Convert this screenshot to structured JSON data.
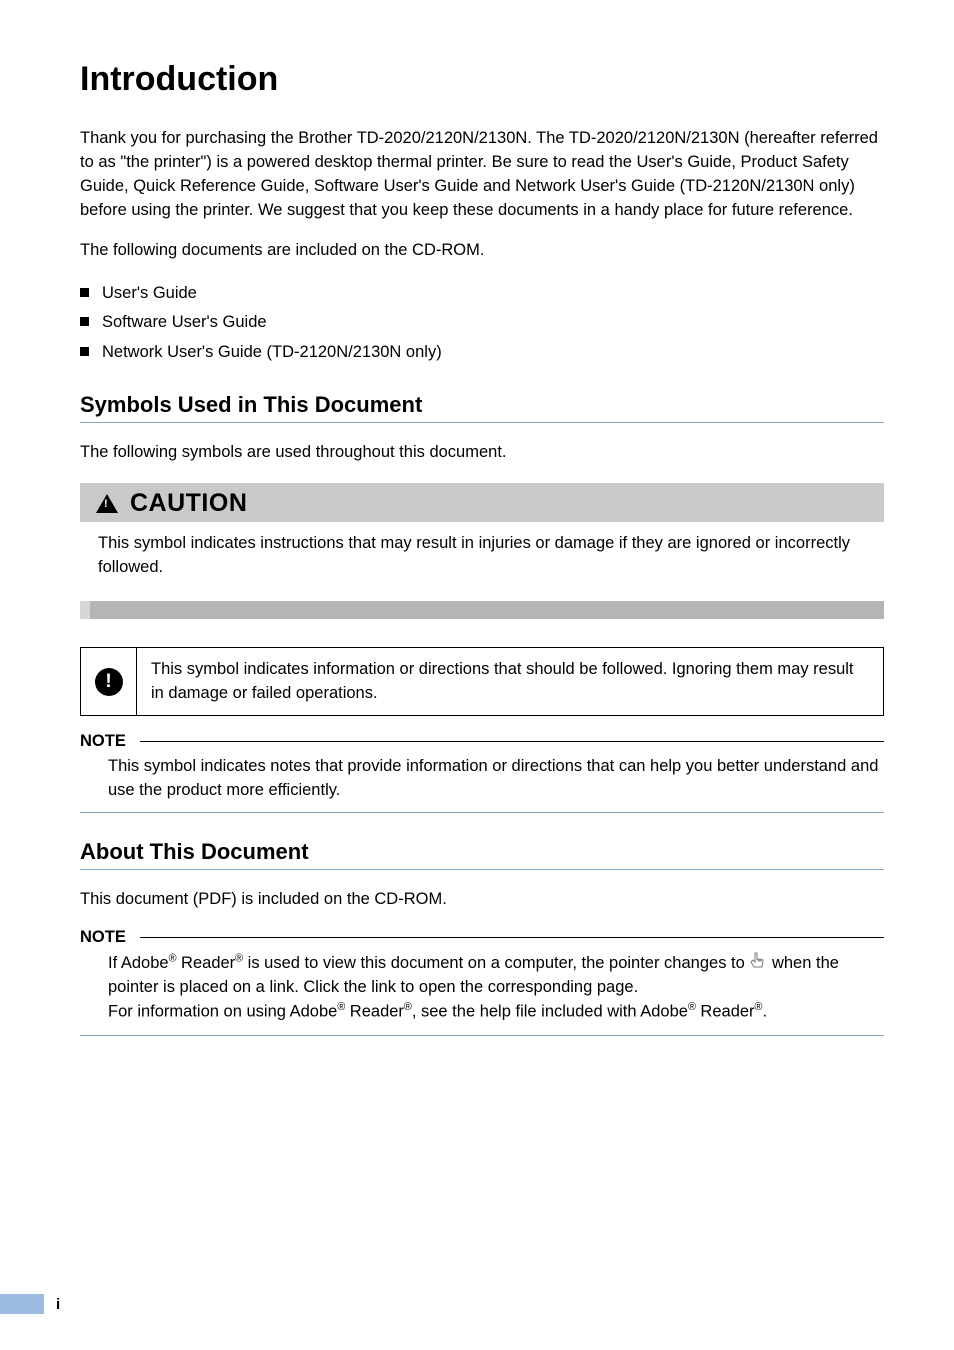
{
  "title": "Introduction",
  "intro_para": "Thank you for purchasing the Brother TD-2020/2120N/2130N. The TD-2020/2120N/2130N (hereafter referred to as \"the printer\") is a powered desktop thermal printer. Be sure to read the User's Guide, Product Safety Guide, Quick Reference Guide, Software User's Guide and Network User's Guide (TD-2120N/2130N only) before using the printer. We suggest that you keep these documents in a handy place for future reference.",
  "cdrom_line": "The following documents are included on the CD-ROM.",
  "cdrom_items": [
    "User's Guide",
    "Software User's Guide",
    "Network User's Guide (TD-2120N/2130N only)"
  ],
  "sec1": {
    "heading": "Symbols Used in This Document",
    "lead": "The following symbols are used throughout this document."
  },
  "caution": {
    "label": "CAUTION",
    "text": "This symbol indicates instructions that may result in injuries or damage if they are ignored or incorrectly followed."
  },
  "important": {
    "text": "This symbol indicates information or directions that should be followed. Ignoring them may result in damage or failed operations."
  },
  "note1": {
    "label": "NOTE",
    "text": "This symbol indicates notes that provide information or directions that can help you better understand and use the product more efficiently."
  },
  "sec2": {
    "heading": "About This Document",
    "lead": "This document (PDF) is included on the CD-ROM."
  },
  "note2": {
    "label": "NOTE",
    "line1a": "If Adobe",
    "line1b": " Reader",
    "line1c": " is used to view this document on a computer, the pointer changes to ",
    "line2": " when the pointer is placed on a link. Click the link to open the corresponding page.",
    "line3a": "For information on using Adobe",
    "line3b": " Reader",
    "line3c": ", see the help file included with Adobe",
    "line3d": " Reader",
    "period": "."
  },
  "page_number": "i"
}
